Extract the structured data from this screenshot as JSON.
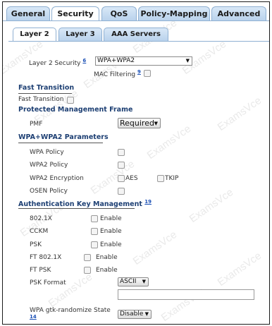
{
  "top_tabs": [
    "General",
    "Security",
    "QoS",
    "Policy-Mapping",
    "Advanced"
  ],
  "sub_tabs": [
    "Layer 2",
    "Layer 3",
    "AAA Servers"
  ],
  "layer2": {
    "security_label": "Layer 2 Security",
    "security_ref": "6",
    "security_value": "WPA+WPA2",
    "mac_label": "MAC Filtering",
    "mac_ref": "9"
  },
  "fast_transition": {
    "heading": "Fast Transition",
    "label": "Fast Transition"
  },
  "pmf": {
    "heading": "Protected Management Frame",
    "label": "PMF",
    "value": "Required"
  },
  "wpa": {
    "heading": "WPA+WPA2 Parameters",
    "policy_label": "WPA Policy",
    "policy2_label": "WPA2 Policy",
    "encryption_label": "WPA2 Encryption",
    "aes": "AES",
    "tkip": "TKIP",
    "osen_label": "OSEN Policy"
  },
  "akm": {
    "heading": "Authentication Key Management",
    "heading_ref": "19",
    "rows": [
      {
        "label": "802.1X",
        "enable": "Enable"
      },
      {
        "label": "CCKM",
        "enable": "Enable"
      },
      {
        "label": "PSK",
        "enable": "Enable"
      },
      {
        "label": "FT 802.1X",
        "enable": "Enable"
      },
      {
        "label": "FT PSK",
        "enable": "Enable"
      }
    ],
    "psk_format_label": "PSK Format",
    "psk_format_value": "ASCII",
    "gtk_label": "WPA gtk-randomize State",
    "gtk_ref": "14",
    "gtk_value": "Disable"
  },
  "watermark": "ExamsVce"
}
